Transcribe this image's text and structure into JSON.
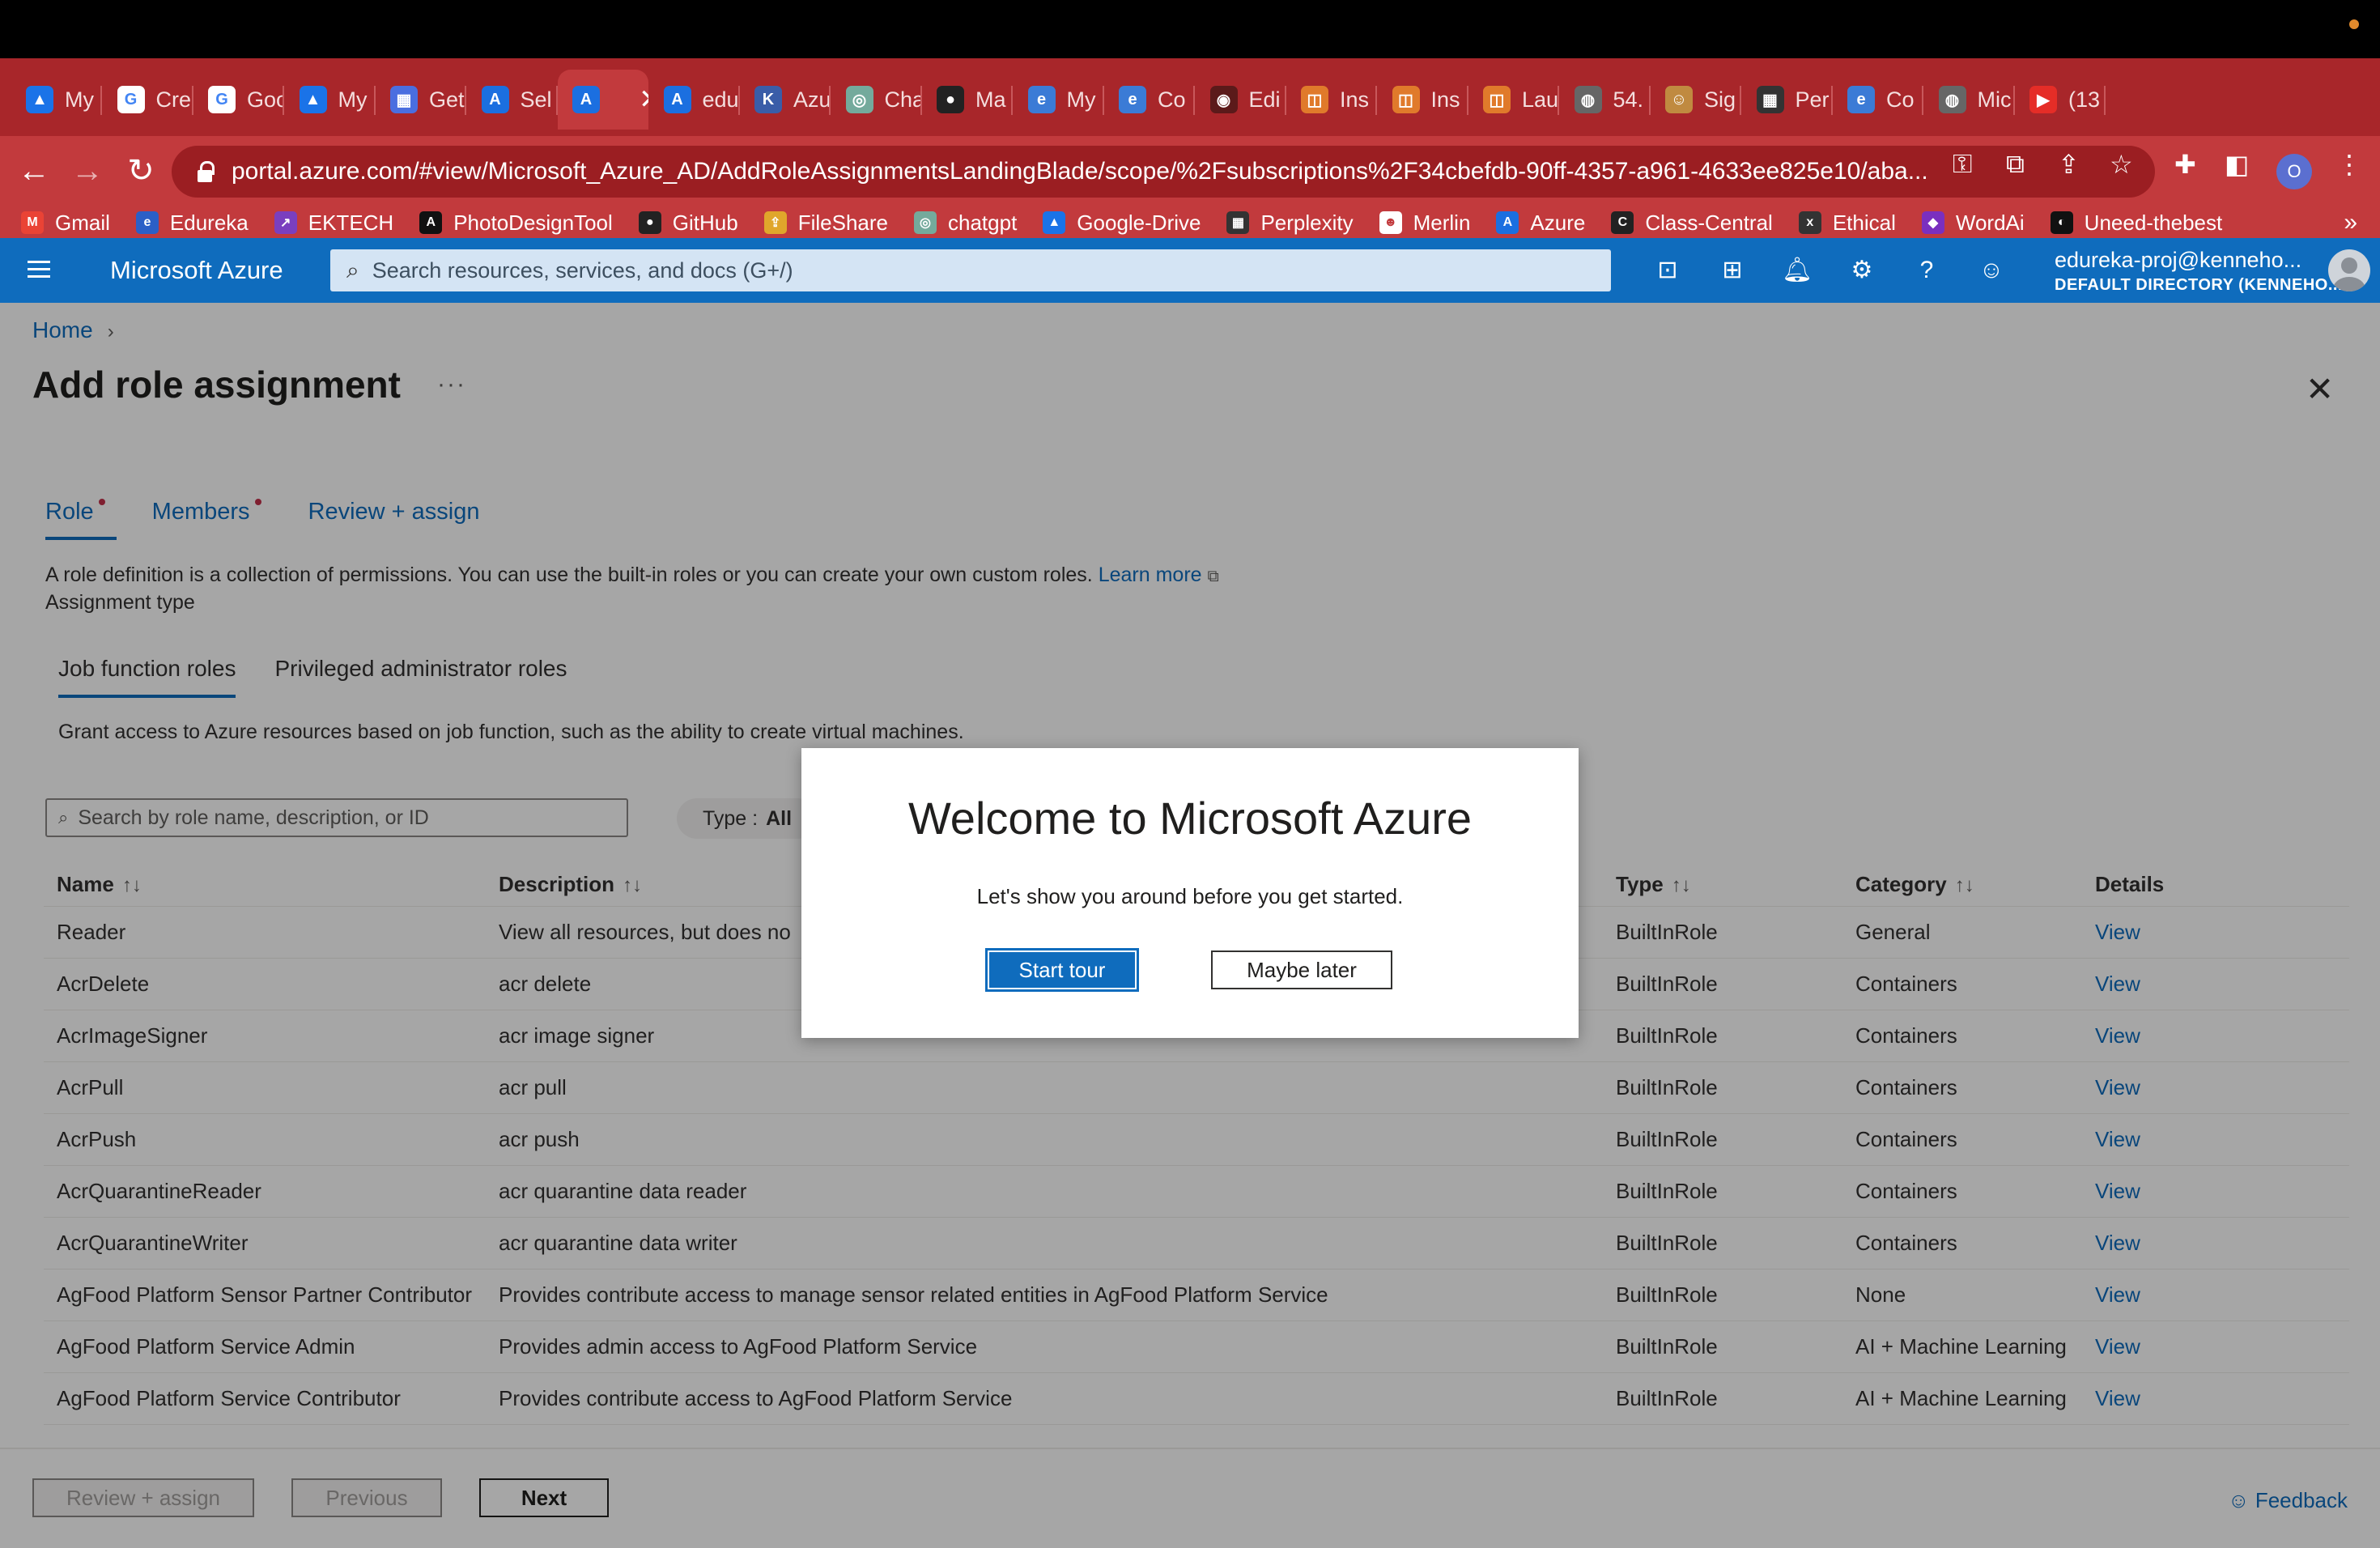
{
  "browser": {
    "tabs": [
      {
        "label": "My",
        "color": "#1a73e8",
        "glyph": "▲"
      },
      {
        "label": "Cre",
        "color": "#ffffff",
        "glyph": "G"
      },
      {
        "label": "Goo",
        "color": "#ffffff",
        "glyph": "G"
      },
      {
        "label": "My",
        "color": "#1a73e8",
        "glyph": "▲"
      },
      {
        "label": "Get",
        "color": "#4a6ee0",
        "glyph": "▦"
      },
      {
        "label": "Sel",
        "color": "#1b6fe0",
        "glyph": "A"
      },
      {
        "label": "",
        "color": "#1b6fe0",
        "glyph": "A"
      },
      {
        "label": "edu",
        "color": "#1b6fe0",
        "glyph": "A"
      },
      {
        "label": "Azu",
        "color": "#3a5da8",
        "glyph": "K"
      },
      {
        "label": "Cha",
        "color": "#74aa9c",
        "glyph": "◎"
      },
      {
        "label": "Ma",
        "color": "#222222",
        "glyph": "●"
      },
      {
        "label": "My",
        "color": "#3b7bd6",
        "glyph": "e"
      },
      {
        "label": "Co",
        "color": "#3b7bd6",
        "glyph": "e"
      },
      {
        "label": "Edi",
        "color": "#5b1a1a",
        "glyph": "◉"
      },
      {
        "label": "Ins",
        "color": "#e07a2b",
        "glyph": "◫"
      },
      {
        "label": "Ins",
        "color": "#e07a2b",
        "glyph": "◫"
      },
      {
        "label": "Lau",
        "color": "#e07a2b",
        "glyph": "◫"
      },
      {
        "label": "54.",
        "color": "#666666",
        "glyph": "◍"
      },
      {
        "label": "Sig",
        "color": "#c08a40",
        "glyph": "☺"
      },
      {
        "label": "Per",
        "color": "#333333",
        "glyph": "▦"
      },
      {
        "label": "Co",
        "color": "#3b7bd6",
        "glyph": "e"
      },
      {
        "label": "Mic",
        "color": "#666666",
        "glyph": "◍"
      },
      {
        "label": "(13",
        "color": "#e52d27",
        "glyph": "▶"
      }
    ],
    "active_tab_close": "✕",
    "new_tab": "+",
    "url": "portal.azure.com/#view/Microsoft_Azure_AD/AddRoleAssignmentsLandingBlade/scope/%2Fsubscriptions%2F34cbefdb-90ff-4357-a961-4633ee825e10/aba...",
    "profile_initial": "O",
    "bookmarks": [
      {
        "label": "Gmail",
        "color": "#ea4335",
        "glyph": "M"
      },
      {
        "label": "Edureka",
        "color": "#2b5fc7",
        "glyph": "e"
      },
      {
        "label": "EKTECH",
        "color": "#7a3fbf",
        "glyph": "↗"
      },
      {
        "label": "PhotoDesignTool",
        "color": "#111111",
        "glyph": "A"
      },
      {
        "label": "GitHub",
        "color": "#222222",
        "glyph": "●"
      },
      {
        "label": "FileShare",
        "color": "#e0a62b",
        "glyph": "⇪"
      },
      {
        "label": "chatgpt",
        "color": "#74aa9c",
        "glyph": "◎"
      },
      {
        "label": "Google-Drive",
        "color": "#1a73e8",
        "glyph": "▲"
      },
      {
        "label": "Perplexity",
        "color": "#333333",
        "glyph": "▦"
      },
      {
        "label": "Merlin",
        "color": "#ffffff",
        "glyph": "☻"
      },
      {
        "label": "Azure",
        "color": "#1b6fe0",
        "glyph": "A"
      },
      {
        "label": "Class-Central",
        "color": "#222222",
        "glyph": "C"
      },
      {
        "label": "Ethical",
        "color": "#333333",
        "glyph": "x"
      },
      {
        "label": "WordAi",
        "color": "#7a2fbf",
        "glyph": "◆"
      },
      {
        "label": "Uneed-thebest",
        "color": "#111111",
        "glyph": "◐"
      }
    ],
    "bookmarks_more": "»"
  },
  "azure": {
    "brand": "Microsoft Azure",
    "search_placeholder": "Search resources, services, and docs (G+/)",
    "user_email": "edureka-proj@kenneho...",
    "user_directory": "DEFAULT DIRECTORY (KENNEHO..."
  },
  "page": {
    "breadcrumb_home": "Home",
    "title": "Add role assignment",
    "more": "···",
    "tabs": [
      "Role",
      "Members",
      "Review + assign"
    ],
    "description": "A role definition is a collection of permissions. You can use the built-in roles or you can create your own custom roles.",
    "learn_more": "Learn more",
    "assignment_type": "Assignment type",
    "subtabs": [
      "Job function roles",
      "Privileged administrator roles"
    ],
    "grant_text": "Grant access to Azure resources based on job function, such as the ability to create virtual machines.",
    "role_search_placeholder": "Search by role name, description, or ID",
    "type_filter_label": "Type :",
    "type_filter_value": "All",
    "columns": [
      "Name",
      "Description",
      "Type",
      "Category",
      "Details"
    ],
    "rows": [
      {
        "name": "Reader",
        "desc": "View all resources, but does no",
        "type": "BuiltInRole",
        "category": "General",
        "details": "View"
      },
      {
        "name": "AcrDelete",
        "desc": "acr delete",
        "type": "BuiltInRole",
        "category": "Containers",
        "details": "View"
      },
      {
        "name": "AcrImageSigner",
        "desc": "acr image signer",
        "type": "BuiltInRole",
        "category": "Containers",
        "details": "View"
      },
      {
        "name": "AcrPull",
        "desc": "acr pull",
        "type": "BuiltInRole",
        "category": "Containers",
        "details": "View"
      },
      {
        "name": "AcrPush",
        "desc": "acr push",
        "type": "BuiltInRole",
        "category": "Containers",
        "details": "View"
      },
      {
        "name": "AcrQuarantineReader",
        "desc": "acr quarantine data reader",
        "type": "BuiltInRole",
        "category": "Containers",
        "details": "View"
      },
      {
        "name": "AcrQuarantineWriter",
        "desc": "acr quarantine data writer",
        "type": "BuiltInRole",
        "category": "Containers",
        "details": "View"
      },
      {
        "name": "AgFood Platform Sensor Partner Contributor",
        "desc": "Provides contribute access to manage sensor related entities in AgFood Platform Service",
        "type": "BuiltInRole",
        "category": "None",
        "details": "View"
      },
      {
        "name": "AgFood Platform Service Admin",
        "desc": "Provides admin access to AgFood Platform Service",
        "type": "BuiltInRole",
        "category": "AI + Machine Learning",
        "details": "View"
      },
      {
        "name": "AgFood Platform Service Contributor",
        "desc": "Provides contribute access to AgFood Platform Service",
        "type": "BuiltInRole",
        "category": "AI + Machine Learning",
        "details": "View"
      }
    ],
    "footer": {
      "review_assign": "Review + assign",
      "previous": "Previous",
      "next": "Next",
      "feedback": "Feedback"
    }
  },
  "modal": {
    "title": "Welcome to Microsoft Azure",
    "subtitle": "Let's show you around before you get started.",
    "start": "Start tour",
    "later": "Maybe later"
  }
}
